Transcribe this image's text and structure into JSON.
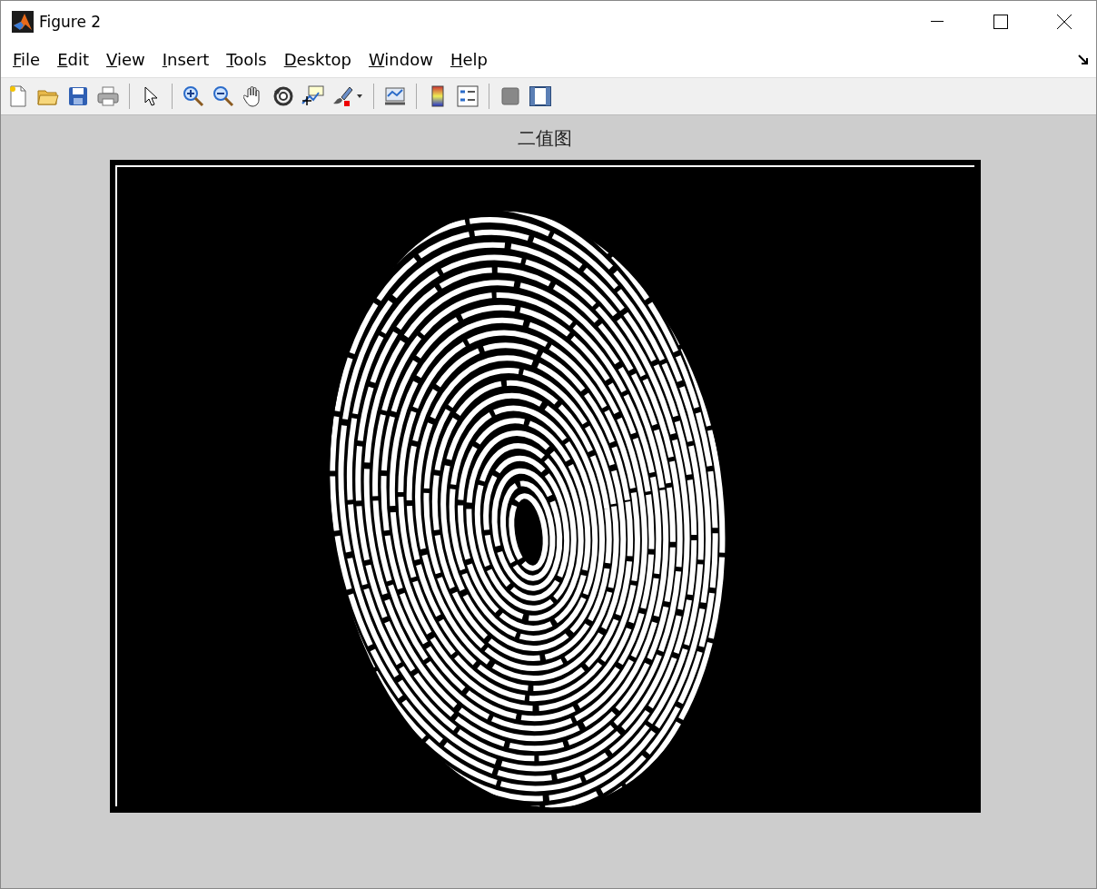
{
  "window": {
    "title": "Figure 2"
  },
  "menu": [
    "File",
    "Edit",
    "View",
    "Insert",
    "Tools",
    "Desktop",
    "Window",
    "Help"
  ],
  "toolbar": [
    {
      "kind": "new"
    },
    {
      "kind": "open"
    },
    {
      "kind": "save"
    },
    {
      "kind": "print"
    },
    {
      "kind": "sep"
    },
    {
      "kind": "pointer"
    },
    {
      "kind": "sep"
    },
    {
      "kind": "zoom-in"
    },
    {
      "kind": "zoom-out"
    },
    {
      "kind": "pan"
    },
    {
      "kind": "rotate"
    },
    {
      "kind": "data-cursor"
    },
    {
      "kind": "brush"
    },
    {
      "kind": "sep"
    },
    {
      "kind": "link"
    },
    {
      "kind": "sep"
    },
    {
      "kind": "colorbar"
    },
    {
      "kind": "legend"
    },
    {
      "kind": "sep"
    },
    {
      "kind": "hide-tools"
    },
    {
      "kind": "show-tools"
    }
  ],
  "axes": {
    "title": "二值图"
  }
}
